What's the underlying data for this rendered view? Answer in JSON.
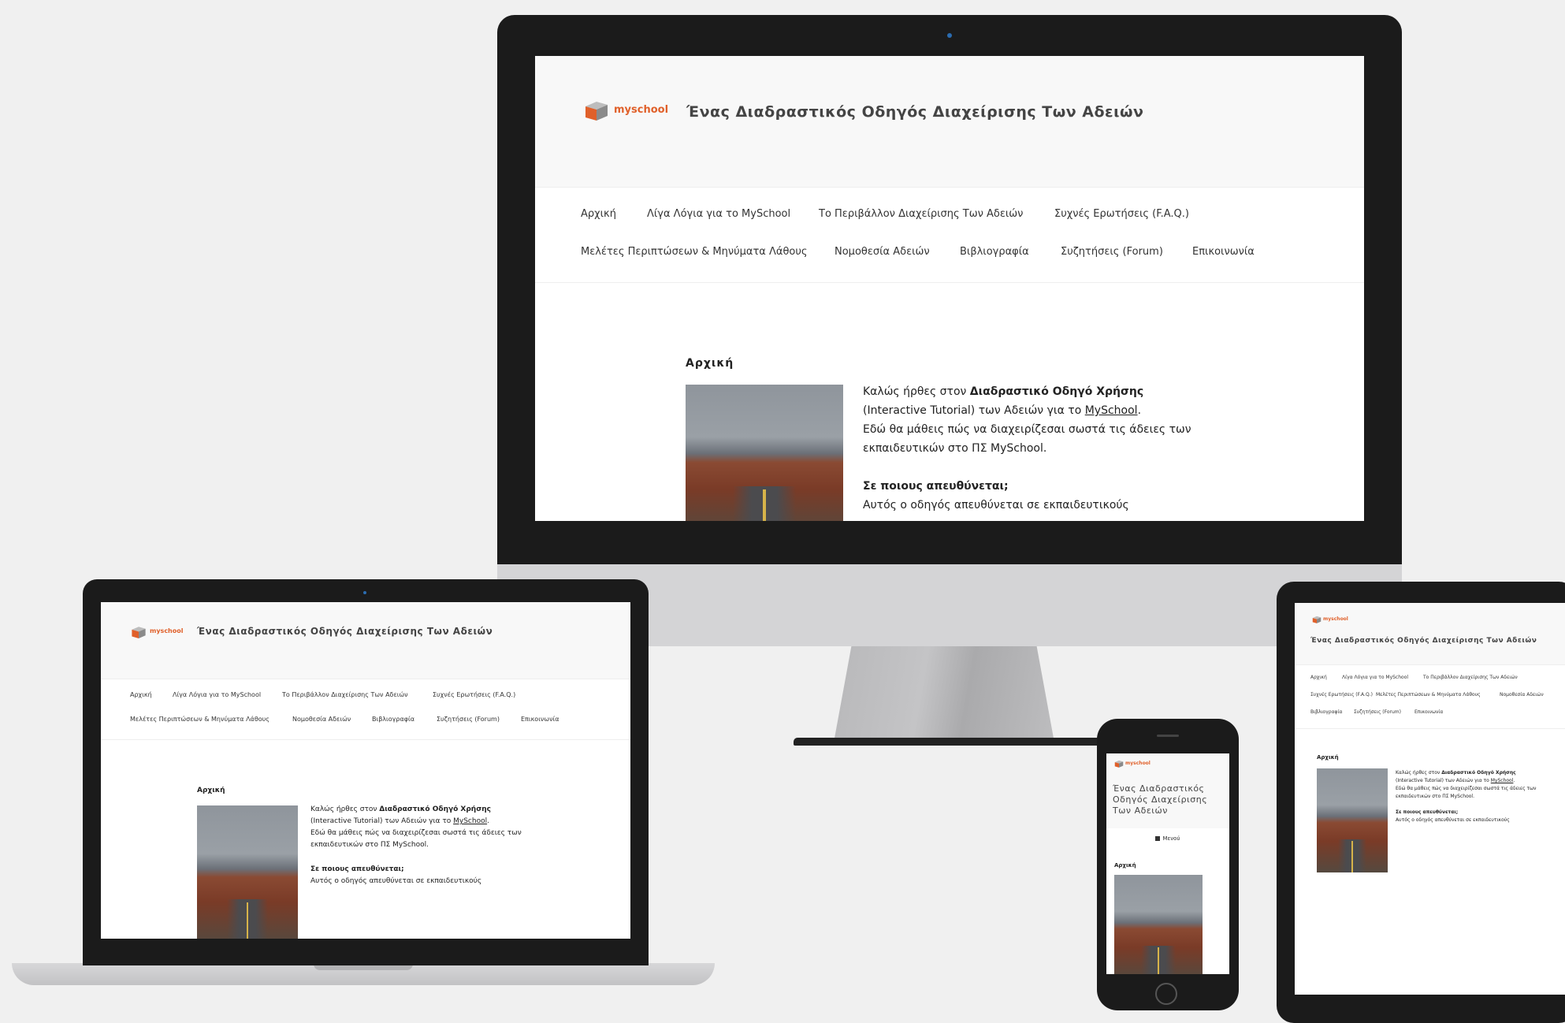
{
  "logo": {
    "text": "myschool"
  },
  "site_title": "Ένας Διαδραστικός Οδηγός Διαχείρισης Των Αδειών",
  "nav_row1": [
    "Αρχική",
    "Λίγα Λόγια για το MySchool",
    "Το Περιβάλλον Διαχείρισης Των Αδειών",
    "Συχνές Ερωτήσεις (F.A.Q.)"
  ],
  "nav_row2": [
    "Μελέτες Περιπτώσεων & Μηνύματα Λάθους",
    "Νομοθεσία Αδειών",
    "Βιβλιογραφία",
    "Συζητήσεις (Forum)",
    "Επικοινωνία"
  ],
  "content": {
    "heading": "Αρχική",
    "p1_a": "Καλώς ήρθες στον ",
    "p1_b": "Διαδραστικό Οδηγό Χρήσης",
    "p1_c": "(Interactive Tutorial) των Αδειών για το ",
    "p1_link": "MySchool",
    "p1_d": ".",
    "p2": "Εδώ θα μάθεις πώς να διαχειρίζεσαι σωστά τις άδειες των",
    "p3": "εκπαιδευτικών στο ΠΣ MySchool.",
    "q": "Σε ποιους απευθύνεται;",
    "a1": "Αυτός ο οδηγός απευθύνεται σε εκπαιδευτικούς"
  },
  "mobile": {
    "menu_label": "Μενού"
  },
  "colors": {
    "bezel": "#1b1b1b",
    "stand": "#c8c8ca",
    "accent": "#e0602a"
  }
}
